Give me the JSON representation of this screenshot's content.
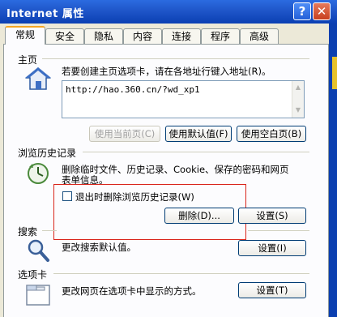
{
  "window": {
    "title": "Internet 属性",
    "help_label": "?",
    "close_label": "✕"
  },
  "tabs": [
    "常规",
    "安全",
    "隐私",
    "内容",
    "连接",
    "程序",
    "高级"
  ],
  "home": {
    "section_title": "主页",
    "description": "若要创建主页选项卡，请在各地址行键入地址(R)。",
    "url": "http://hao.360.cn/?wd_xp1",
    "use_current_label": "使用当前页(C)",
    "use_default_label": "使用默认值(F)",
    "use_blank_label": "使用空白页(B)"
  },
  "history": {
    "section_title": "浏览历史记录",
    "description_line1": "删除临时文件、历史记录、Cookie、保存的密码和网页",
    "description_line2": "表单信息。",
    "checkbox_label": "退出时删除浏览历史记录(W)",
    "checkbox_checked": false,
    "delete_label": "删除(D)...",
    "settings_label": "设置(S)"
  },
  "search": {
    "section_title": "搜索",
    "description": "更改搜索默认值。",
    "settings_label": "设置(I)"
  },
  "tabs_section": {
    "section_title": "选项卡",
    "description": "更改网页在选项卡中显示的方式。",
    "settings_label": "设置(T)"
  },
  "colors": {
    "titlebar": "#0a3fb3",
    "highlight_box": "#d9251b"
  }
}
